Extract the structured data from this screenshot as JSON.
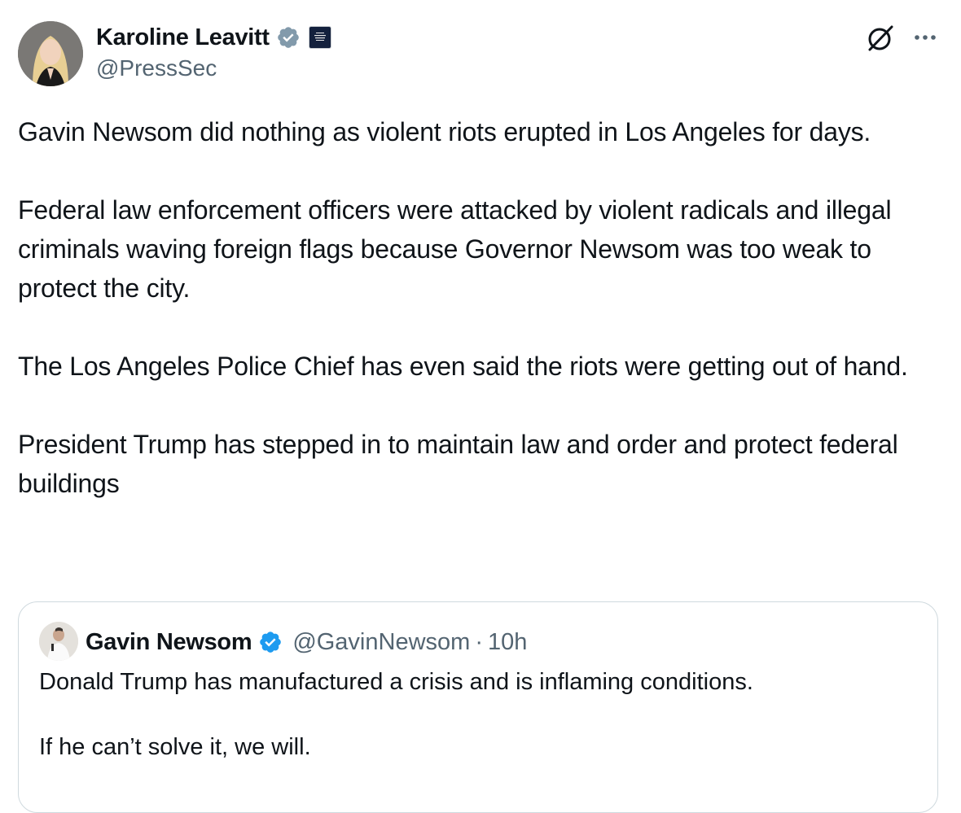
{
  "author": {
    "display_name": "Karoline Leavitt",
    "handle": "@PressSec",
    "affiliation_badge": "WHITE HOUSE",
    "verified_badge_color": "#829aab"
  },
  "icons": [
    "grok-icon",
    "more-options-icon"
  ],
  "tweet": {
    "paragraphs": [
      "Gavin Newsom did nothing as violent riots erupted in Los Angeles for days.",
      "Federal law enforcement officers were attacked by violent radicals and illegal criminals waving foreign flags because Governor Newsom was too weak to protect the city.",
      "The Los Angeles Police Chief has even said the riots were getting out of hand.",
      "President Trump has stepped in to maintain law and order and protect federal buildings"
    ]
  },
  "quoted": {
    "display_name": "Gavin Newsom",
    "handle": "@GavinNewsom",
    "separator": "·",
    "time": "10h",
    "verified_badge_color": "#1d9bf0",
    "paragraphs": [
      "Donald Trump has manufactured a crisis and is inflaming conditions.",
      "If he can’t solve it, we will."
    ]
  },
  "colors": {
    "text": "#0f1419",
    "secondary": "#536471",
    "border": "#cfd9de"
  }
}
